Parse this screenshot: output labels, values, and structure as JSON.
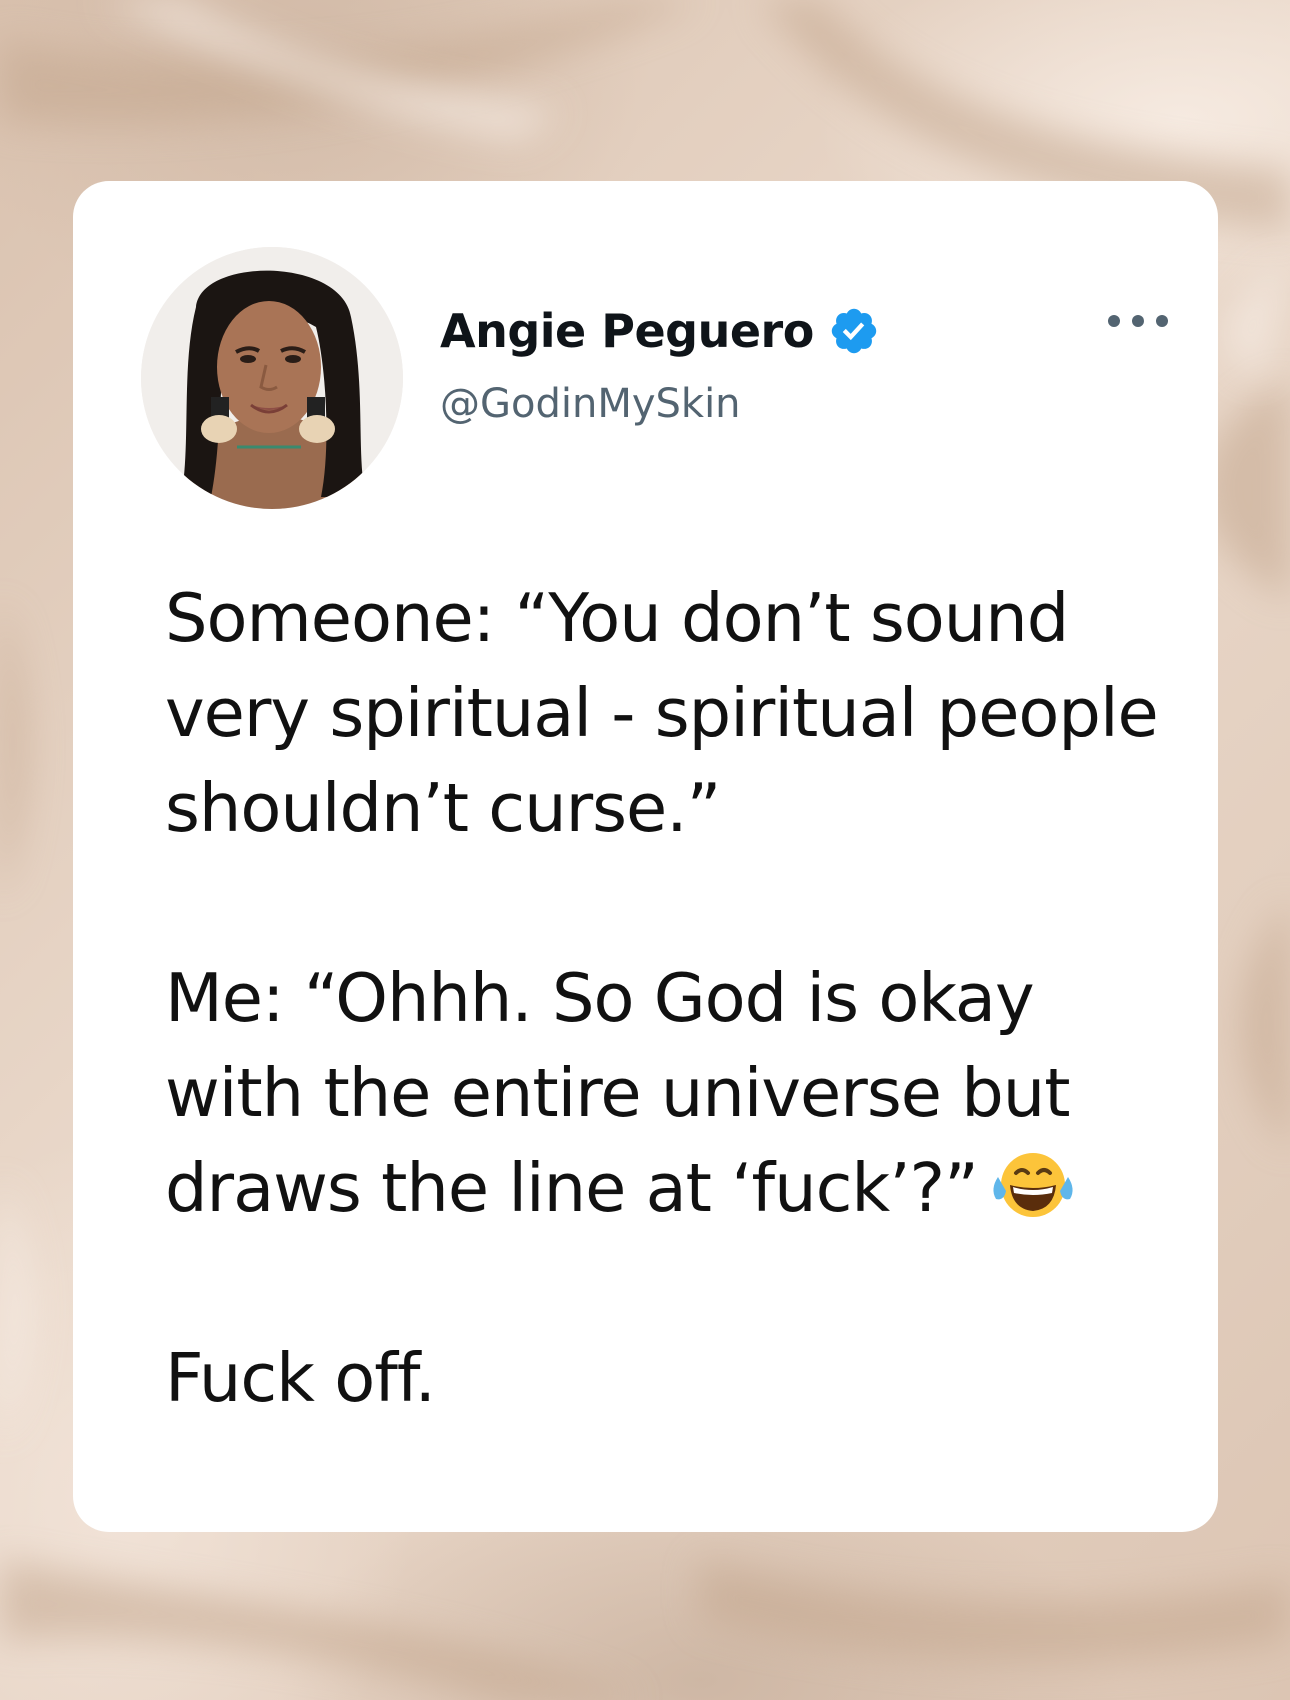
{
  "tweet": {
    "author_name": "Angie Peguero",
    "author_handle": "@GodinMySkin",
    "verified": true,
    "paragraphs": [
      "Someone: “You don’t sound very spiritual - spiritual people shouldn’t curse.”",
      "Me: “Ohhh. So God is okay with the entire universe but draws the line at ‘fuck’?”",
      "Fuck off."
    ],
    "emoji": "face-with-tears-of-joy"
  },
  "icons": {
    "verified": "verified-badge-icon",
    "more": "more-options-icon",
    "avatar": "profile-avatar"
  },
  "colors": {
    "background": "#e6d4c6",
    "card": "#ffffff",
    "verified_blue": "#1d9bf0",
    "text": "#111111",
    "handle": "#536471"
  }
}
